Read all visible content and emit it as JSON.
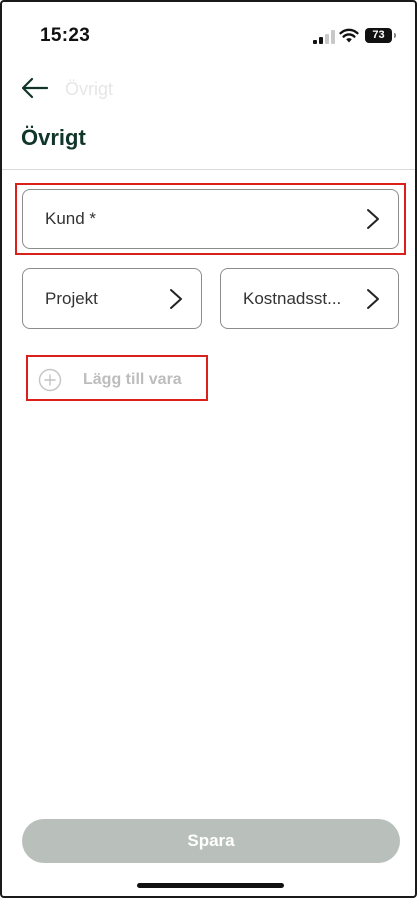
{
  "status_bar": {
    "time": "15:23",
    "battery_level": "73"
  },
  "nav": {
    "faded_title": "Övrigt"
  },
  "page": {
    "title": "Övrigt"
  },
  "fields": {
    "customer": {
      "label": "Kund *"
    },
    "project": {
      "label": "Projekt"
    },
    "cost_center": {
      "label": "Kostnadsst..."
    }
  },
  "add_item": {
    "label": "Lägg till vara"
  },
  "save_button": {
    "label": "Spara"
  },
  "colors": {
    "title": "#11352a",
    "highlight": "#d9201a",
    "save_disabled": "#b9c0bc",
    "add_item_text": "#bdbdbd"
  },
  "icons": [
    "back-arrow-icon",
    "chevron-right-icon",
    "plus-circle-icon",
    "signal-icon",
    "wifi-icon",
    "battery-icon"
  ]
}
